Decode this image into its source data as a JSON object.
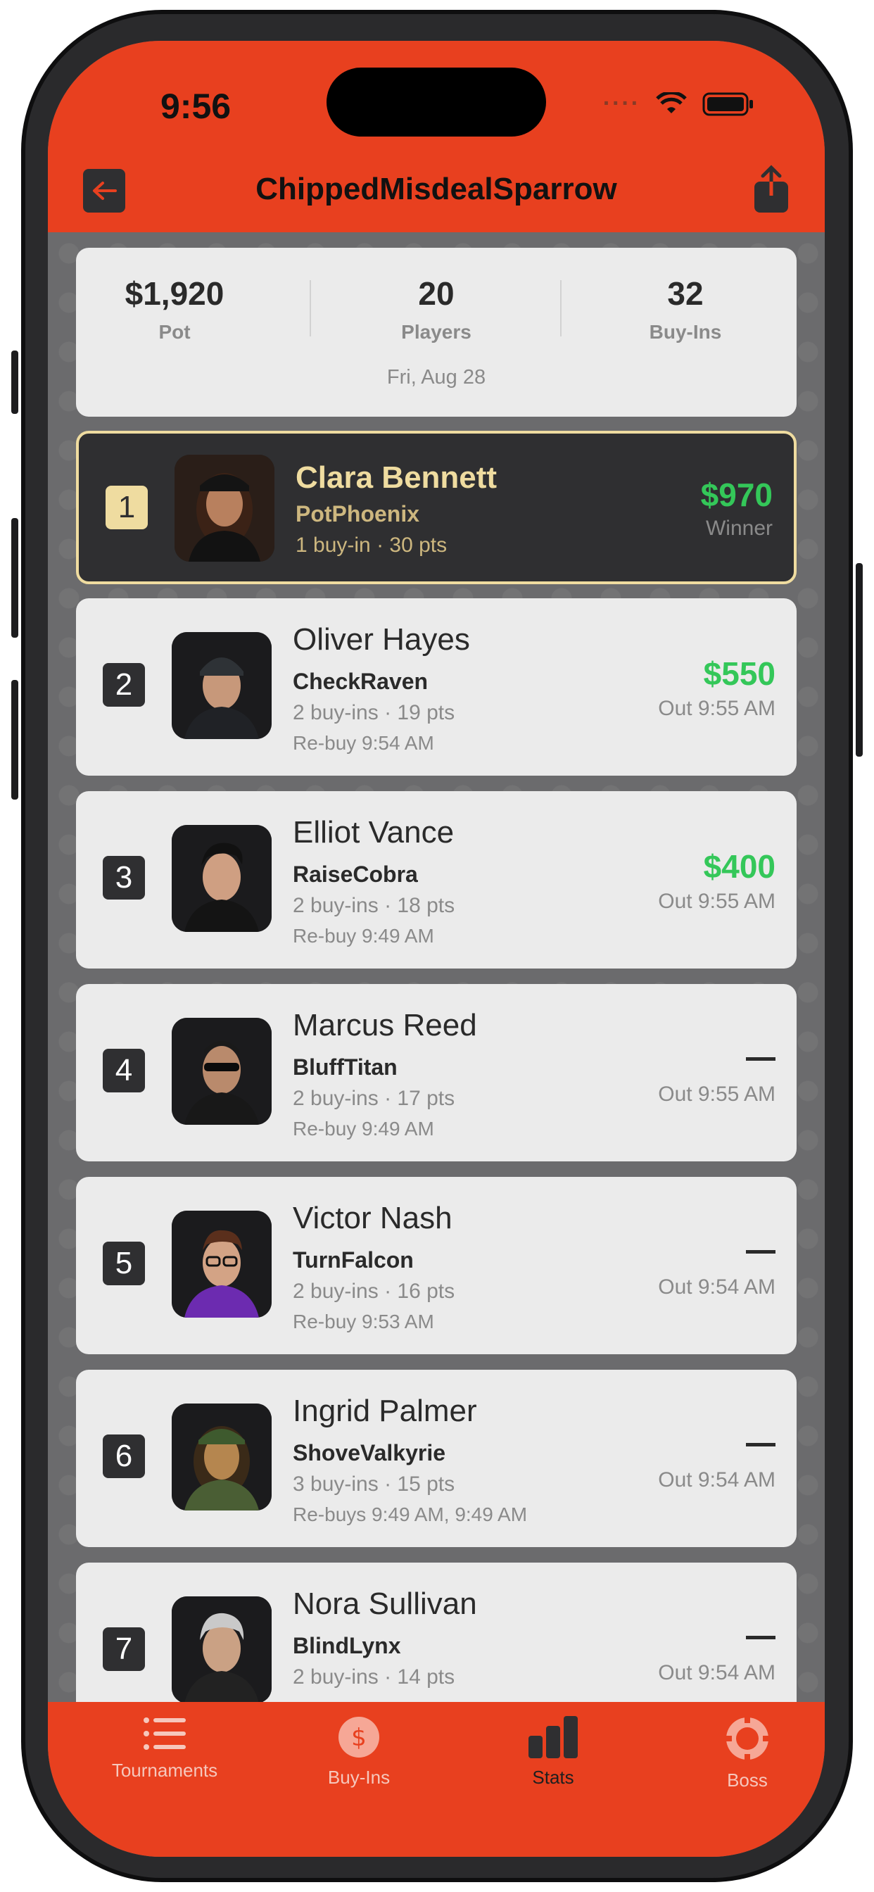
{
  "status": {
    "time": "9:56"
  },
  "nav": {
    "title": "ChippedMisdealSparrow"
  },
  "summary": {
    "pot_value": "$1,920",
    "pot_label": "Pot",
    "players_value": "20",
    "players_label": "Players",
    "buyins_value": "32",
    "buyins_label": "Buy-Ins",
    "date": "Fri, Aug 28"
  },
  "players": [
    {
      "rank": "1",
      "name": "Clara Bennett",
      "nick": "PotPhoenix",
      "meta": "1 buy-in · 30 pts",
      "rebuy": "",
      "amount": "$970",
      "status": "Winner"
    },
    {
      "rank": "2",
      "name": "Oliver Hayes",
      "nick": "CheckRaven",
      "meta": "2 buy-ins · 19 pts",
      "rebuy": "Re-buy 9:54 AM",
      "amount": "$550",
      "status": "Out 9:55 AM"
    },
    {
      "rank": "3",
      "name": "Elliot Vance",
      "nick": "RaiseCobra",
      "meta": "2 buy-ins · 18 pts",
      "rebuy": "Re-buy 9:49 AM",
      "amount": "$400",
      "status": "Out 9:55 AM"
    },
    {
      "rank": "4",
      "name": "Marcus Reed",
      "nick": "BluffTitan",
      "meta": "2 buy-ins · 17 pts",
      "rebuy": "Re-buy 9:49 AM",
      "amount": "",
      "status": "Out 9:55 AM"
    },
    {
      "rank": "5",
      "name": "Victor Nash",
      "nick": "TurnFalcon",
      "meta": "2 buy-ins · 16 pts",
      "rebuy": "Re-buy 9:53 AM",
      "amount": "",
      "status": "Out 9:54 AM"
    },
    {
      "rank": "6",
      "name": "Ingrid Palmer",
      "nick": "ShoveValkyrie",
      "meta": "3 buy-ins · 15 pts",
      "rebuy": "Re-buys 9:49 AM, 9:49 AM",
      "amount": "",
      "status": "Out 9:54 AM"
    },
    {
      "rank": "7",
      "name": "Nora Sullivan",
      "nick": "BlindLynx",
      "meta": "2 buy-ins · 14 pts",
      "rebuy": "",
      "amount": "",
      "status": "Out 9:54 AM"
    }
  ],
  "tabs": [
    {
      "label": "Tournaments",
      "icon": "list-icon"
    },
    {
      "label": "Buy-Ins",
      "icon": "dollar-icon"
    },
    {
      "label": "Stats",
      "icon": "bar-chart-icon",
      "active": true
    },
    {
      "label": "Boss",
      "icon": "poker-chip-icon"
    }
  ],
  "colors": {
    "accent": "#e8401f",
    "winner_gold": "#efdca0",
    "money_green": "#34c759"
  }
}
